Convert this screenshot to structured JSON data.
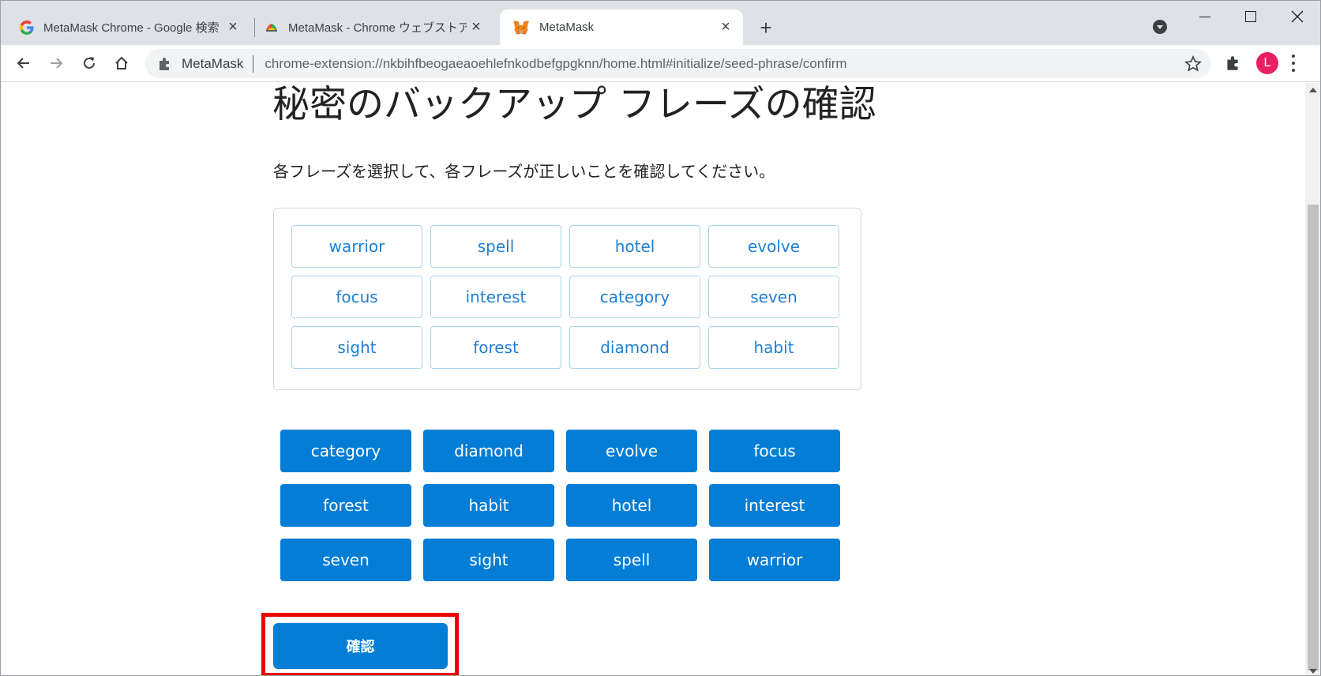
{
  "browser": {
    "tabs": [
      {
        "title": "MetaMask Chrome - Google 検索",
        "icon": "google-icon",
        "active": false
      },
      {
        "title": "MetaMask - Chrome ウェブストア",
        "icon": "chrome-web-store-icon",
        "active": false
      },
      {
        "title": "MetaMask",
        "icon": "metamask-fox-icon",
        "active": true
      }
    ],
    "newtab_label": "+",
    "address": {
      "site_name": "MetaMask",
      "url": "chrome-extension://nkbihfbeogaeaoehlefnkodbefgpgknn/home.html#initialize/seed-phrase/confirm"
    },
    "profile_initial": "L",
    "profile_color": "#e91e63"
  },
  "page": {
    "title": "秘密のバックアップ フレーズの確認",
    "description": "各フレーズを選択して、各フレーズが正しいことを確認してください。",
    "selected_words": [
      "warrior",
      "spell",
      "hotel",
      "evolve",
      "focus",
      "interest",
      "category",
      "seven",
      "sight",
      "forest",
      "diamond",
      "habit"
    ],
    "available_words": [
      "category",
      "diamond",
      "evolve",
      "focus",
      "forest",
      "habit",
      "hotel",
      "interest",
      "seven",
      "sight",
      "spell",
      "warrior"
    ],
    "confirm_label": "確認"
  },
  "colors": {
    "accent": "#037dd6",
    "selected_word_text": "#1f7fd6",
    "highlight": "#ee0000"
  }
}
